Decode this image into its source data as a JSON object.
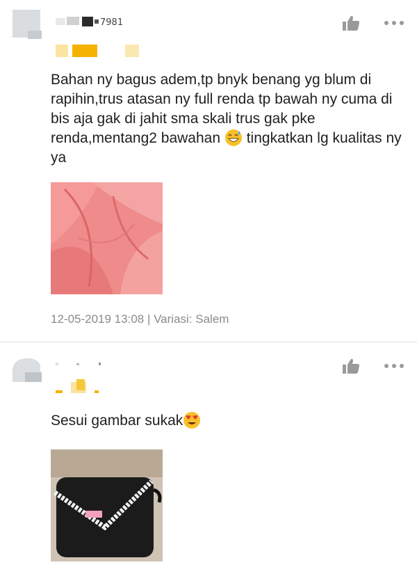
{
  "reviews": [
    {
      "comment_text": "Bahan ny bagus adem,tp bnyk benang yg blum di rapihin,trus atasan ny full renda tp bawah ny cuma di bis aja gak di jahit sma skali trus gak pke renda,mentang2 bawahan",
      "comment_after_emoji": " tingkatkan lg kualitas ny ya",
      "emoji": "grinning-sweat-emoji",
      "photo": "pink-fabric-photo",
      "date": "12-05-2019 13:08",
      "separator": " | ",
      "variation": "Variasi: Salem"
    },
    {
      "comment_text": "Sesui gambar sukak",
      "emoji": "heart-eyes-emoji",
      "photo": "black-pouch-with-lace-photo"
    }
  ],
  "colors": {
    "star": "#f5b300",
    "meta": "#8a8a8a",
    "icon": "#9a9a9a",
    "divider": "#e0e0e0"
  },
  "icons": [
    "avatar-icon",
    "thumbs-up-icon",
    "more-options-icon"
  ]
}
